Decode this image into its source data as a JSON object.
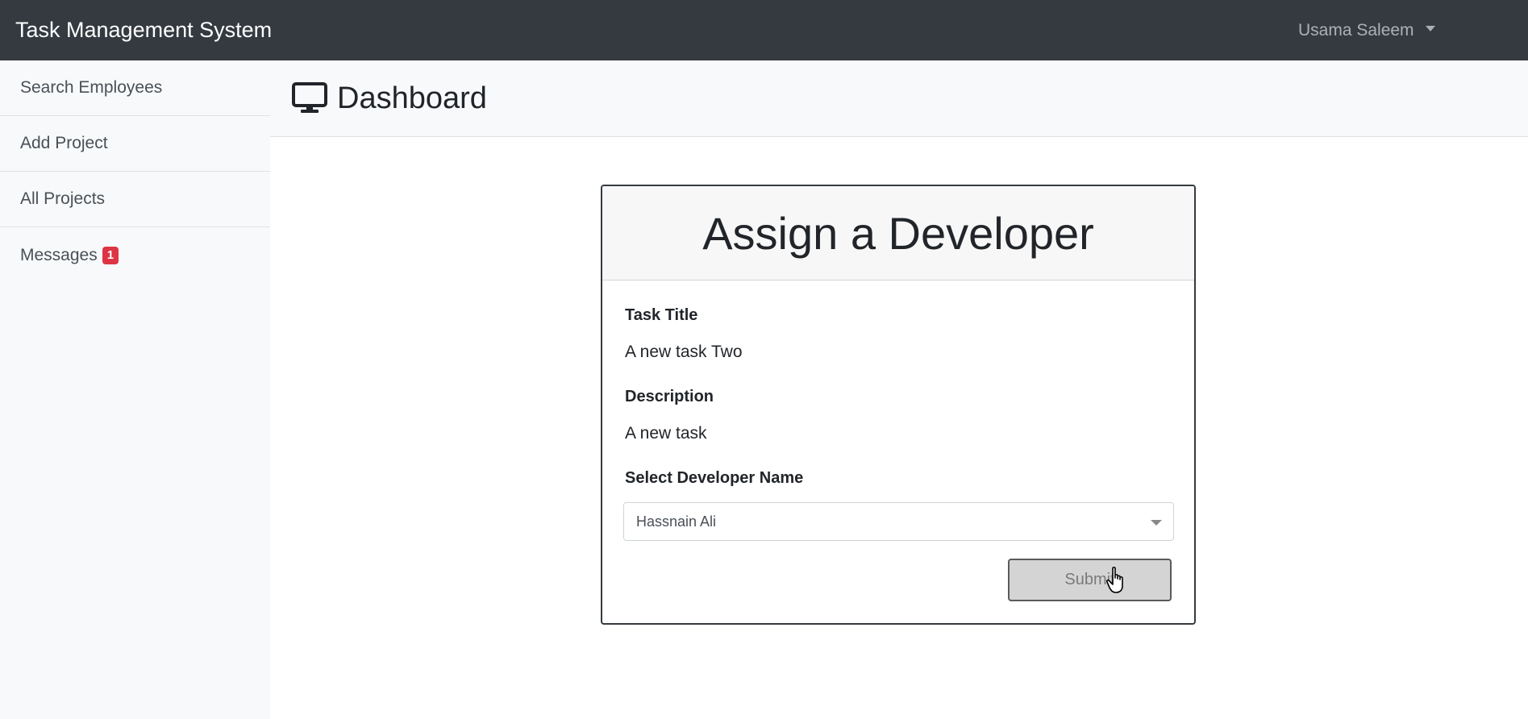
{
  "navbar": {
    "brand": "Task Management System",
    "user_name": "Usama Saleem"
  },
  "sidebar": {
    "items": [
      {
        "label": "Search Employees"
      },
      {
        "label": "Add Project"
      },
      {
        "label": "All Projects"
      },
      {
        "label": "Messages",
        "badge": "1"
      }
    ]
  },
  "header": {
    "title": "Dashboard",
    "icon": "monitor-icon"
  },
  "form": {
    "title": "Assign a Developer",
    "task_title_label": "Task Title",
    "task_title_value": "A new task Two",
    "description_label": "Description",
    "description_value": "A new task",
    "developer_label": "Select Developer Name",
    "developer_selected": "Hassnain Ali",
    "submit_label": "Submit"
  },
  "colors": {
    "navbar_bg": "#343a40",
    "badge_bg": "#dc3545",
    "sidebar_bg": "#f8f9fa"
  }
}
